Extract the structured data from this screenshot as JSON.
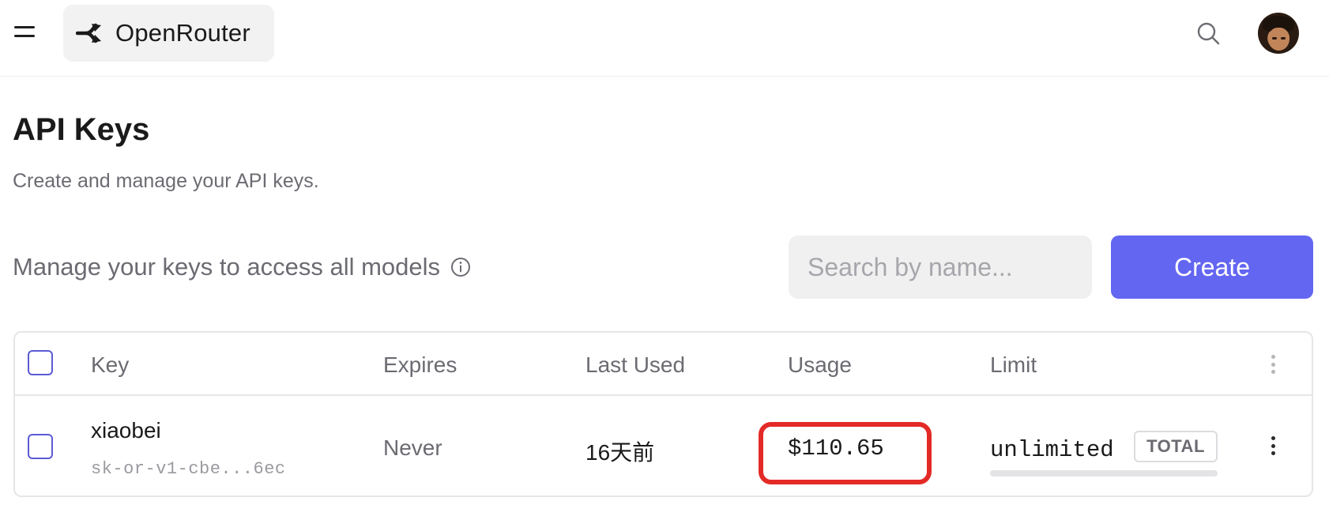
{
  "header": {
    "brand_name": "OpenRouter",
    "icons": {
      "menu": "hamburger-menu-icon",
      "logo": "openrouter-logo-icon",
      "search": "search-icon",
      "avatar": "user-avatar"
    }
  },
  "page": {
    "title": "API Keys",
    "subtitle": "Create and manage your API keys."
  },
  "toolbar": {
    "manage_text": "Manage your keys to access all models",
    "info_icon": "info-icon",
    "search_placeholder": "Search by name...",
    "create_label": "Create"
  },
  "table": {
    "columns": [
      "Key",
      "Expires",
      "Last Used",
      "Usage",
      "Limit"
    ],
    "rows": [
      {
        "name": "xiaobei",
        "masked_key": "sk-or-v1-cbe...6ec",
        "expires": "Never",
        "last_used": "16天前",
        "usage": "$110.65",
        "limit": "unlimited",
        "limit_type": "TOTAL",
        "limit_progress": 0
      }
    ]
  },
  "colors": {
    "accent": "#6366f1",
    "highlight_outline": "#e32a26",
    "muted_text": "#6b6b72"
  }
}
